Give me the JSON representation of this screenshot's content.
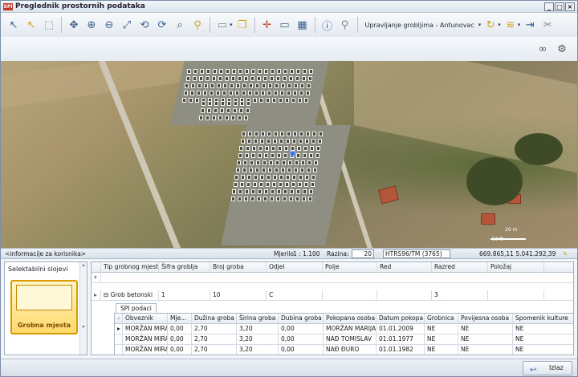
{
  "window": {
    "title": "Preglednik prostornih podataka",
    "logo": "SPI",
    "buttons": [
      "_",
      "□",
      "×"
    ]
  },
  "toolbar": {
    "cemetery_selector": "Upravljanje grobljima - Antunovac",
    "icons": [
      "select-arrow-icon",
      "select-yellow-icon",
      "select-box-icon",
      "pan-icon",
      "zoom-in-icon",
      "zoom-out-icon",
      "zoom-extent-icon",
      "zoom-prev-icon",
      "zoom-next-icon",
      "zoom-layer-icon",
      "zoom-select-icon",
      "page-icon",
      "layers-icon",
      "cursor-cross-icon",
      "measure-icon",
      "print-icon",
      "info-icon",
      "find-icon"
    ]
  },
  "status": {
    "user_info": "<informacije za korisnika>",
    "scale_label": "Mjerilo",
    "scale_value": "1 : 1.100",
    "level_label": "Razina:",
    "level_value": "20",
    "crs": "HTRS96/TM (3765)",
    "coordinates": "669.865,11   5.041.292,39"
  },
  "map": {
    "scale_labels": [
      "20 m",
      "50 ft"
    ]
  },
  "layers_panel": {
    "title": "Selektabilni slojevi",
    "selected_layer": "Grobna mjesta"
  },
  "grid": {
    "columns": [
      "Tip grobnog mjesta",
      "Šifra groblja",
      "Broj groba",
      "Odjel",
      "Polje",
      "Red",
      "Razred",
      "Položaj"
    ],
    "row": {
      "tip": "Grob betonski",
      "sifra": "1",
      "broj": "10",
      "odjel": "C",
      "polje": "",
      "red": "",
      "razred": "3",
      "polozaj": ""
    },
    "subtab": "SPI podaci",
    "sub_columns": [
      "Obveznik",
      "Mje...",
      "Dužina groba",
      "Širina groba",
      "Dubina groba",
      "Pokopana osoba",
      "Datum pokopa",
      "Grobnica",
      "Povijesna osoba",
      "Spomenik kulture"
    ],
    "sub_rows": [
      [
        "MORŽAN MIRA",
        "0,00",
        "2,70",
        "3,20",
        "0,00",
        "MORŽAN MARIJA",
        "01.01.2009",
        "NE",
        "NE",
        "NE"
      ],
      [
        "MORŽAN MIRA",
        "0,00",
        "2,70",
        "3,20",
        "0,00",
        "NAĐ TOMISLAV",
        "01.01.1977",
        "NE",
        "NE",
        "NE"
      ],
      [
        "MORŽAN MIRA",
        "0,00",
        "2,70",
        "3,20",
        "0,00",
        "NAĐ ĐURO",
        "01.01.1982",
        "NE",
        "NE",
        "NE"
      ]
    ]
  },
  "footer": {
    "exit_label": "Izlaz"
  }
}
